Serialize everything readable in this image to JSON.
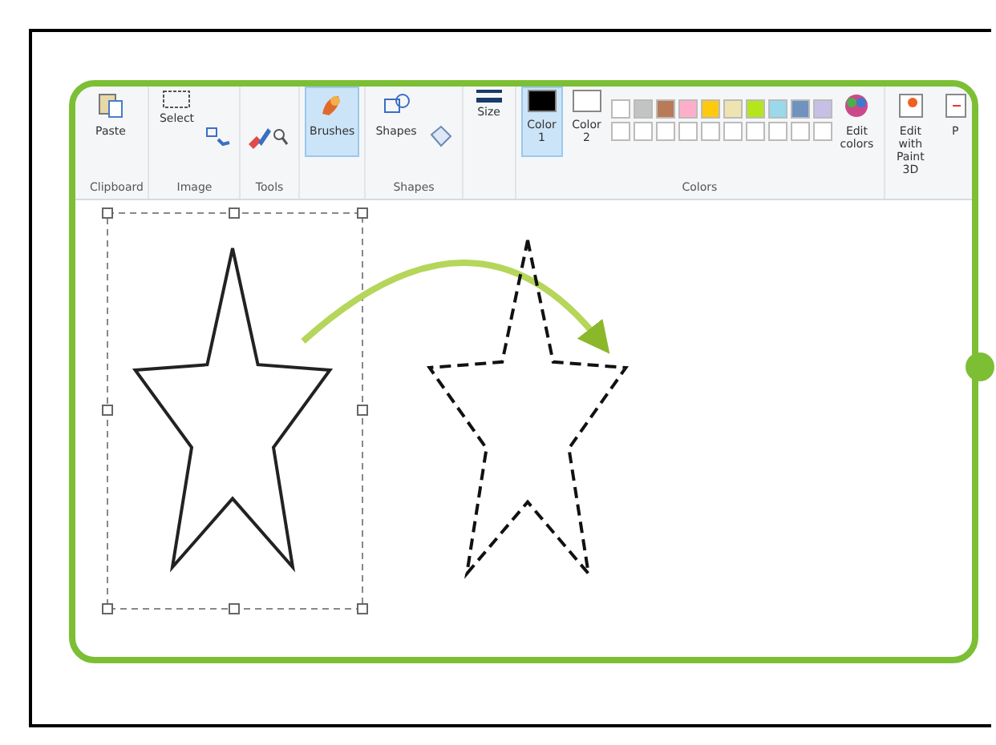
{
  "ribbon": {
    "groups": [
      {
        "label": "Clipboard",
        "buttons": [
          {
            "kind": "large",
            "label": "Paste",
            "selected": false
          }
        ]
      },
      {
        "label": "Image",
        "buttons": [
          {
            "kind": "large",
            "label": "Select",
            "selected": false
          },
          {
            "kind": "tools"
          }
        ]
      },
      {
        "label": "Tools",
        "buttons": [
          {
            "kind": "tools"
          }
        ]
      },
      {
        "buttons": [
          {
            "kind": "large",
            "label": "Brushes",
            "selected": true
          }
        ]
      },
      {
        "label": "Shapes",
        "buttons": [
          {
            "kind": "large",
            "label": "Shapes",
            "selected": false
          },
          {
            "kind": "tools"
          }
        ]
      },
      {
        "buttons": [
          {
            "kind": "large",
            "label": "Size",
            "selected": false
          }
        ]
      },
      {
        "label": "Colors",
        "buttons": [
          {
            "kind": "color",
            "label": "Color 1",
            "color": "#000000",
            "selected": true
          },
          {
            "kind": "color",
            "label": "Color 2",
            "color": "#ffffff",
            "selected": false
          },
          {
            "kind": "palette"
          },
          {
            "kind": "large",
            "label": "Edit colors",
            "selected": false
          }
        ]
      },
      {
        "buttons": [
          {
            "kind": "large",
            "label": "Edit with Paint 3D",
            "selected": false
          },
          {
            "kind": "large",
            "label": "P",
            "selected": false
          }
        ]
      }
    ],
    "palette": [
      {
        "color": "#ffffff"
      },
      {
        "color": "#c3c3c3"
      },
      {
        "color": "#b97a57"
      },
      {
        "color": "#ffaec9"
      },
      {
        "color": "#ffc90e"
      },
      {
        "color": "#efe4b0"
      },
      {
        "color": "#b5e61d"
      },
      {
        "color": "#99d9ea"
      },
      {
        "color": "#7092be"
      },
      {
        "color": "#c8bfe7"
      }
    ]
  }
}
